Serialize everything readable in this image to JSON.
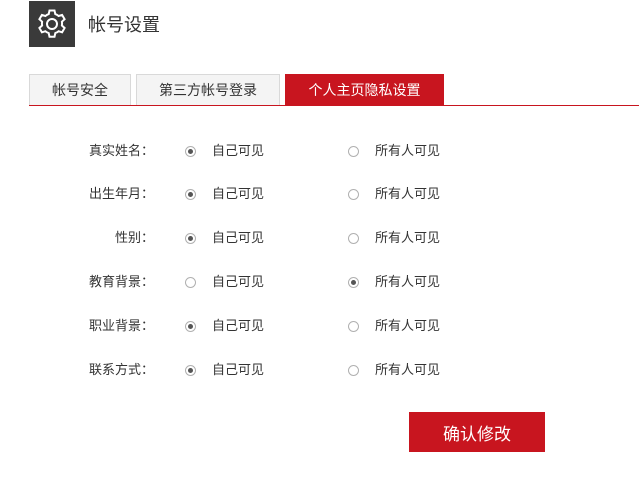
{
  "header": {
    "title": "帐号设置",
    "icon": "gear-icon"
  },
  "tabs": [
    {
      "label": "帐号安全",
      "active": false
    },
    {
      "label": "第三方帐号登录",
      "active": false
    },
    {
      "label": "个人主页隐私设置",
      "active": true
    }
  ],
  "options": {
    "self": "自己可见",
    "everyone": "所有人可见"
  },
  "rows": [
    {
      "label": "真实姓名：",
      "selected": "self"
    },
    {
      "label": "出生年月：",
      "selected": "self"
    },
    {
      "label": "性别：",
      "selected": "self"
    },
    {
      "label": "教育背景：",
      "selected": "everyone"
    },
    {
      "label": "职业背景：",
      "selected": "self"
    },
    {
      "label": "联系方式：",
      "selected": "self"
    }
  ],
  "submit_label": "确认修改",
  "colors": {
    "accent": "#c8151f",
    "header_icon_bg": "#3a3a3a"
  }
}
